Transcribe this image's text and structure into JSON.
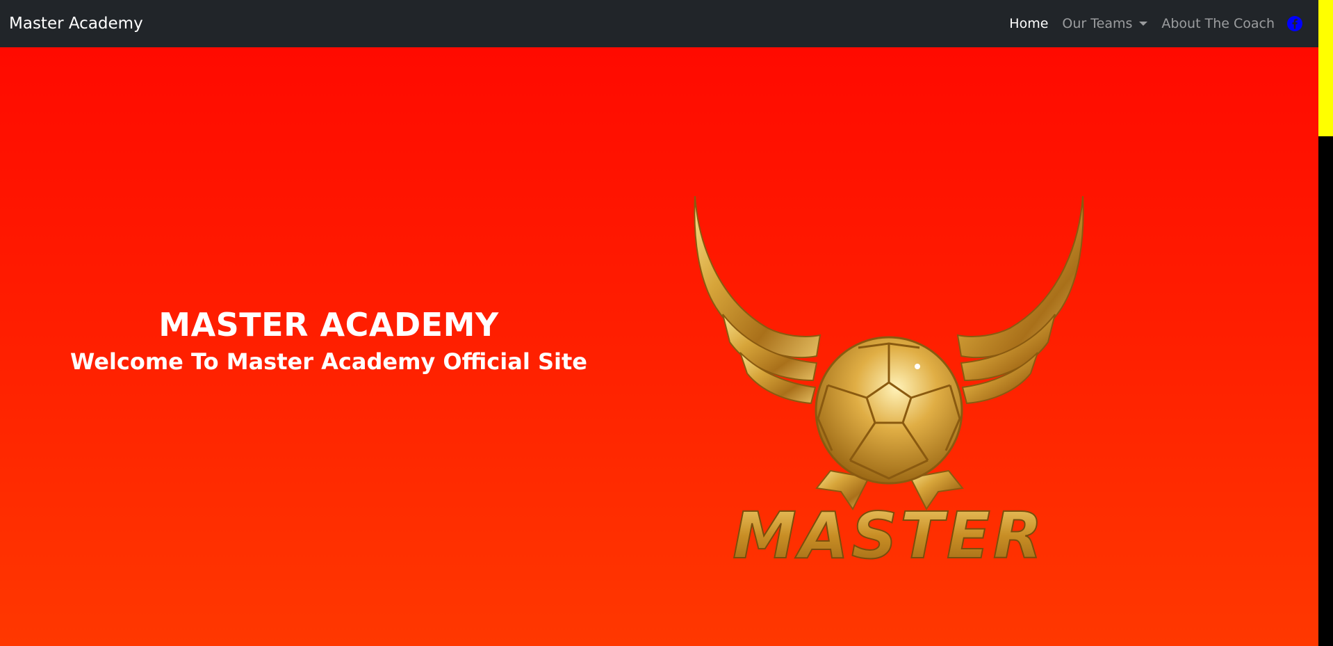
{
  "navbar": {
    "brand": "Master Academy",
    "links": {
      "home": "Home",
      "teams": "Our Teams",
      "coach": "About The Coach"
    },
    "social_icon": "facebook-icon"
  },
  "hero": {
    "title": "MASTER ACADEMY",
    "subtitle": "Welcome To Master Academy Official Site",
    "logo_text": "MASTER"
  },
  "colors": {
    "navbar_bg": "#212529",
    "hero_gradient_top": "#ff0a00",
    "hero_gradient_bottom": "#ff3800",
    "gold": "#c9932a",
    "facebook": "#0000ff",
    "scrollbar_thumb": "#ffff00",
    "scrollbar_track": "#000000"
  }
}
